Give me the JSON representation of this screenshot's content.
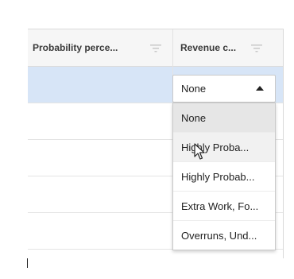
{
  "grid": {
    "columns": [
      {
        "label": "Probability perce...",
        "filter_icon": "filter-lines-icon"
      },
      {
        "label": "Revenue c...",
        "filter_icon": "filter-lines-icon"
      }
    ],
    "selected_row": 1
  },
  "editor": {
    "value": "None",
    "arrow_icon": "triangle-up-icon",
    "options": [
      {
        "label": "None",
        "state": "selected"
      },
      {
        "label": "Highly Proba...",
        "state": "hover"
      },
      {
        "label": "Highly Probab..."
      },
      {
        "label": "Extra Work, Fo..."
      },
      {
        "label": "Overruns, Und..."
      }
    ]
  },
  "colors": {
    "header_bg": "#f6f6f6",
    "selected_row_bg": "#d7e5f7",
    "option_selected_bg": "#e6e6e6"
  }
}
